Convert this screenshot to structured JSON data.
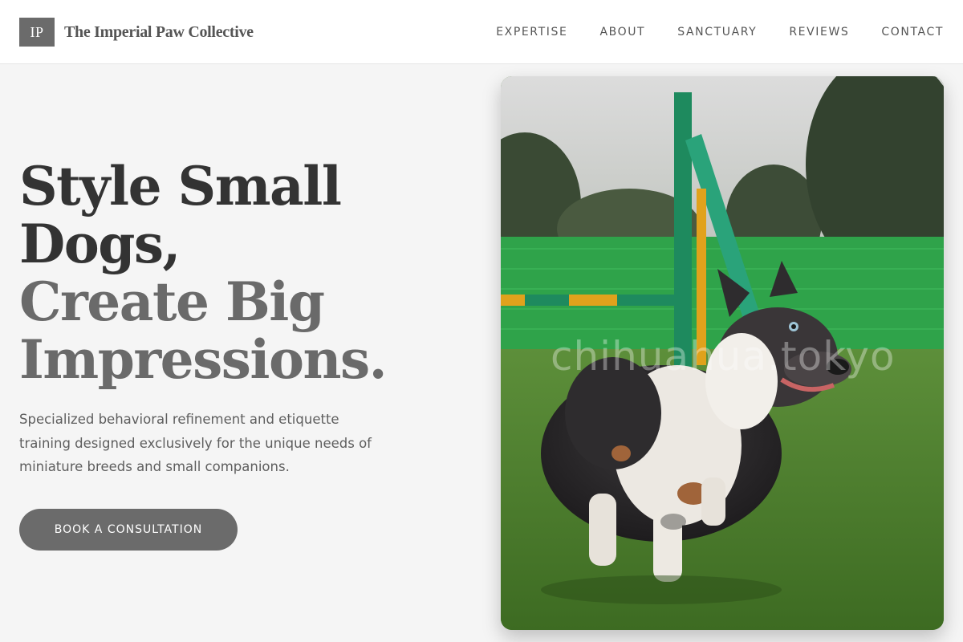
{
  "brand": {
    "monogram": "IP",
    "name": "The Imperial Paw Collective"
  },
  "nav": {
    "items": [
      "EXPERTISE",
      "ABOUT",
      "SANCTUARY",
      "REVIEWS",
      "CONTACT"
    ]
  },
  "hero": {
    "headline_dark_1": "Style Small",
    "headline_dark_2": "Dogs,",
    "headline_light_1": "Create Big",
    "headline_light_2": "Impressions.",
    "subtext": "Specialized behavioral refinement and etiquette training designed exclusively for the unique needs of miniature breeds and small companions.",
    "cta_label": "BOOK A CONSULTATION"
  },
  "photo": {
    "watermark": "chihuahua.tokyo",
    "subject": "dog running on grass agility field"
  },
  "colors": {
    "header_bg": "#ffffff",
    "page_bg": "#f5f5f5",
    "accent_gray": "#6b6b6b",
    "heading_dark": "#333333",
    "heading_light": "#6a6a6a"
  }
}
